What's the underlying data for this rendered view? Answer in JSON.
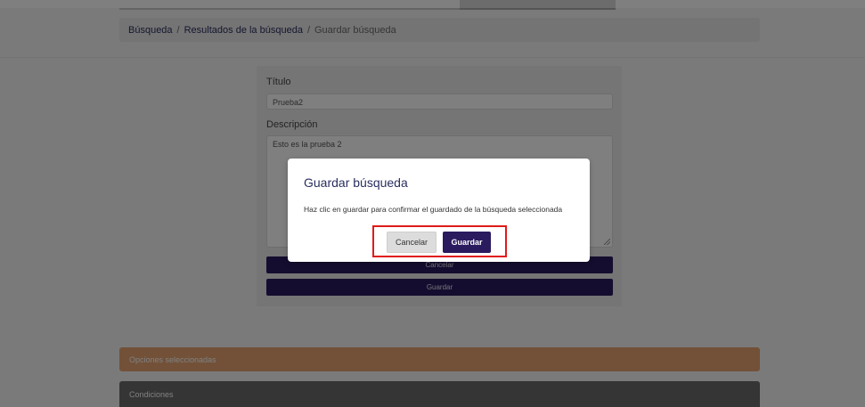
{
  "breadcrumb": {
    "items": [
      "Búsqueda",
      "Resultados de la búsqueda"
    ],
    "separator": "/",
    "current": "Guardar búsqueda"
  },
  "form": {
    "title_label": "Título",
    "title_value": "Prueba2",
    "description_label": "Descripción",
    "description_value": "Esto es la prueba 2",
    "cancel_label": "Cancelar",
    "save_label": "Guardar"
  },
  "accordions": {
    "selected_options": "Opciones seleccionadas",
    "conditions": "Condiciones"
  },
  "modal": {
    "title": "Guardar búsqueda",
    "message": "Haz clic en guardar para confirmar el guardado de la búsqueda seleccionada",
    "cancel_label": "Cancelar",
    "save_label": "Guardar"
  },
  "colors": {
    "primary": "#2a1a5e",
    "accent_orange": "#e5a370",
    "highlight": "#e01b1b"
  }
}
